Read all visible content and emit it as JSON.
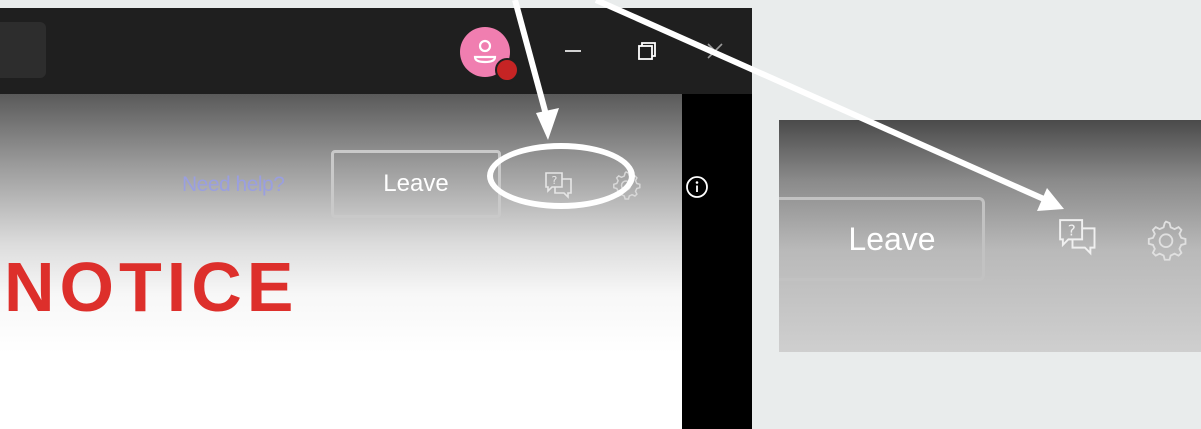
{
  "main_window": {
    "need_help_link": "Need help?",
    "leave_button": "Leave",
    "notice_heading": "NOTICE"
  },
  "zoom_inset": {
    "leave_button": "Leave"
  },
  "icons": {
    "title_bar": [
      "avatar",
      "minimize-icon",
      "restore-icon",
      "close-icon"
    ],
    "toolbar": [
      "help-chat-icon",
      "settings-icon",
      "info-icon"
    ]
  },
  "colors": {
    "title_bar": "#1f1f1f",
    "avatar": "#f07eb0",
    "avatar_status": "#c62424",
    "need_help_link": "#9a9fe0",
    "notice_heading": "#dd2f2b",
    "annotation": "#ffffff",
    "page_background": "#e9ecec"
  }
}
